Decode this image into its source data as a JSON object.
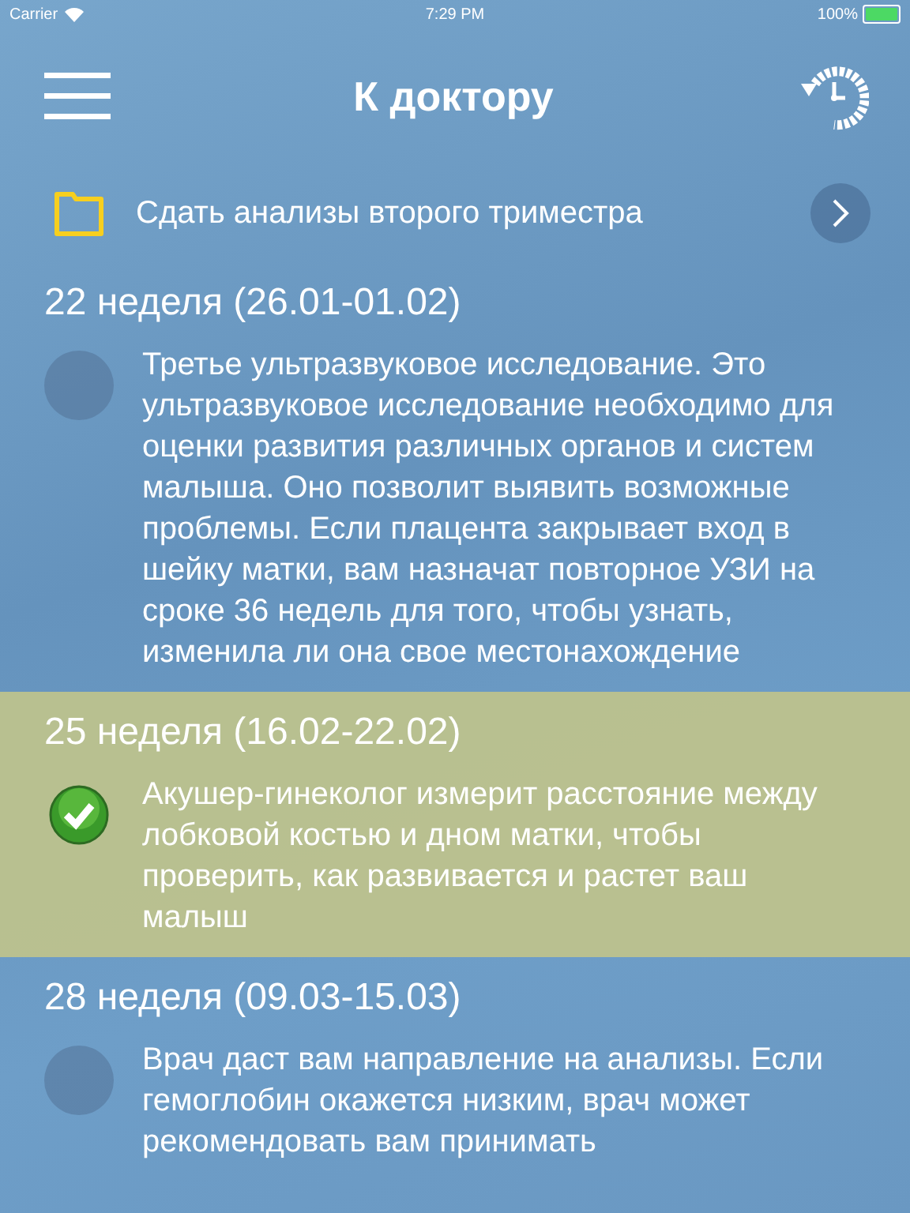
{
  "status_bar": {
    "carrier": "Carrier",
    "time": "7:29 PM",
    "battery": "100%"
  },
  "header": {
    "title": "К доктору"
  },
  "folder": {
    "label": "Сдать анализы второго триместра"
  },
  "weeks": [
    {
      "heading": "22 неделя (26.01-01.02)",
      "text": "Третье ультразвуковое исследование. Это ультразвуковое исследование необходимо для оценки развития различных органов и систем малыша. Оно позволит выявить возможные проблемы. Если плацента закрывает вход в шейку матки, вам назначат повторное УЗИ на сроке 36 недель для того, чтобы узнать, изменила ли она свое местонахождение",
      "done": false
    },
    {
      "heading": "25 неделя (16.02-22.02)",
      "text": "Акушер-гинеколог измерит расстояние между лобковой костью и дном матки, чтобы проверить, как развивается и растет ваш малыш",
      "done": true
    },
    {
      "heading": "28 неделя (09.03-15.03)",
      "text": "Врач даст вам направление на анализы. Если гемоглобин окажется низким, врач может рекомендовать вам принимать",
      "done": false
    }
  ]
}
